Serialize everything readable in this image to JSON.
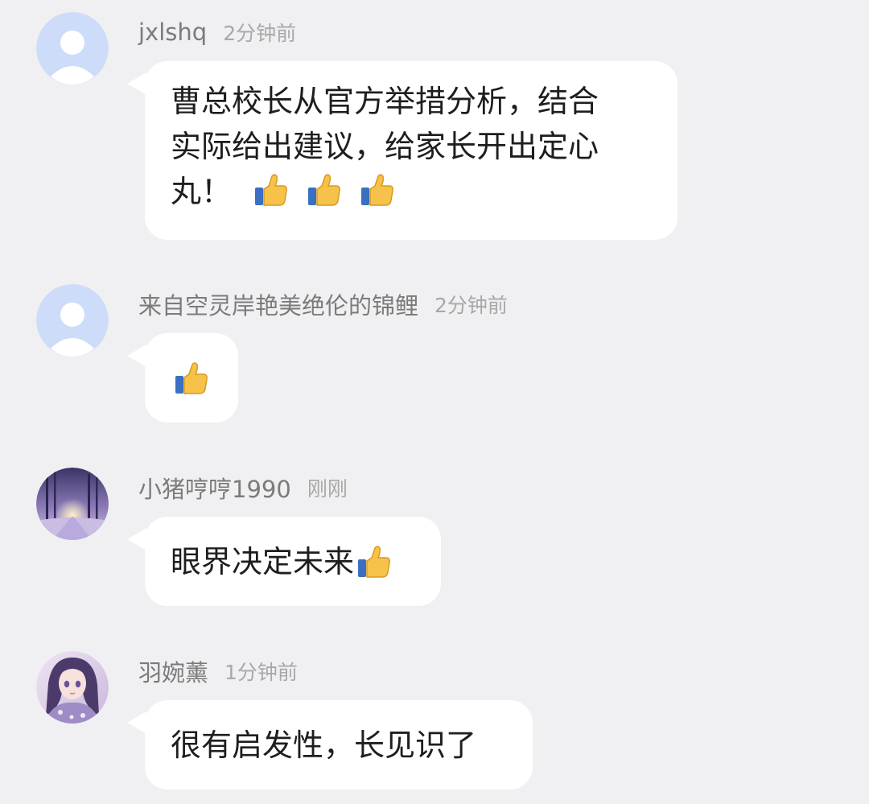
{
  "comments": [
    {
      "username": "jxlshq",
      "time": "2分钟前",
      "text_lines": [
        "曹总校长从官方举措分析，结合",
        "实际给出建议，给家长开出定心",
        "丸！"
      ],
      "emoji_count": 3,
      "avatar": "default-avatar-icon"
    },
    {
      "username": "来自空灵岸艳美绝伦的锦鲤",
      "time": "2分钟前",
      "text_lines": [],
      "emoji_count": 1,
      "avatar": "default-avatar-icon"
    },
    {
      "username": "小猪哼哼1990",
      "time": "刚刚",
      "text_lines": [
        "眼界决定未来"
      ],
      "emoji_count": 1,
      "avatar": "winter-forest-photo"
    },
    {
      "username": "羽婉薰",
      "time": "1分钟前",
      "text_lines": [
        "很有启发性，长见识了"
      ],
      "emoji_count": 0,
      "avatar": "anime-girl-photo"
    }
  ],
  "emoji": "thumbs-up-icon",
  "colors": {
    "background": "#f0f0f2",
    "bubble": "#ffffff",
    "default_avatar": "#cdddf9",
    "username": "#7b7b7b",
    "time": "#a8a8a8"
  }
}
